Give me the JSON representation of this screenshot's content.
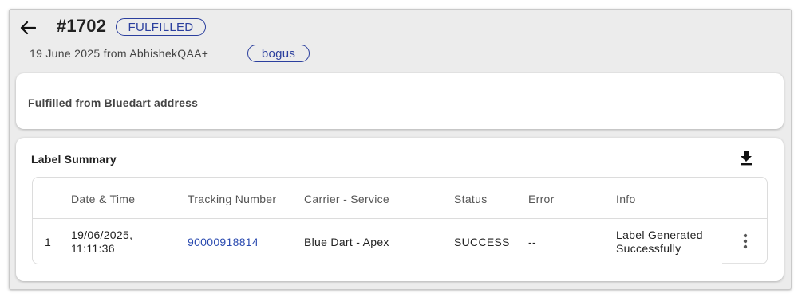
{
  "header": {
    "order_number": "#1702",
    "status": "FULFILLED",
    "subline": "19 June 2025 from AbhishekQAA+",
    "tag": "bogus",
    "back_icon": "arrow-left-icon"
  },
  "fulfillment": {
    "text": "Fulfilled from Bluedart address"
  },
  "label_summary": {
    "title": "Label Summary",
    "download_icon": "download-icon",
    "columns": [
      "Date & Time",
      "Tracking Number",
      "Carrier - Service",
      "Status",
      "Error",
      "Info"
    ],
    "rows": [
      {
        "index": "1",
        "date_line1": "19/06/2025,",
        "date_line2": "11:11:36",
        "tracking_number": "90000918814",
        "carrier_service": "Blue Dart - Apex",
        "status": "SUCCESS",
        "error": "--",
        "info_line1": "Label Generated",
        "info_line2": "Successfully",
        "menu_icon": "more-vertical-icon"
      }
    ]
  },
  "colors": {
    "accent": "#2b3f9e",
    "link": "#2b4bb0",
    "background": "#ececec",
    "card": "#ffffff"
  }
}
